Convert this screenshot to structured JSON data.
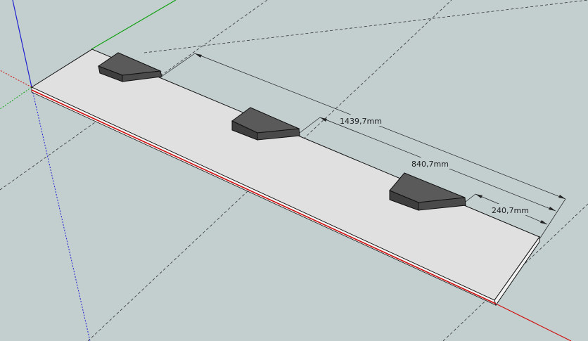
{
  "viewport": {
    "background": "#c3cfcf",
    "axis_colors": {
      "red": "#d01010",
      "green": "#10a010",
      "blue": "#2020d0"
    }
  },
  "model": {
    "board_color": "#e0e0e0",
    "block_color": "#5a5a5a",
    "block_count": 3
  },
  "dimensions": [
    {
      "label": "1439,7mm"
    },
    {
      "label": "840,7mm"
    },
    {
      "label": "240,7mm"
    }
  ]
}
